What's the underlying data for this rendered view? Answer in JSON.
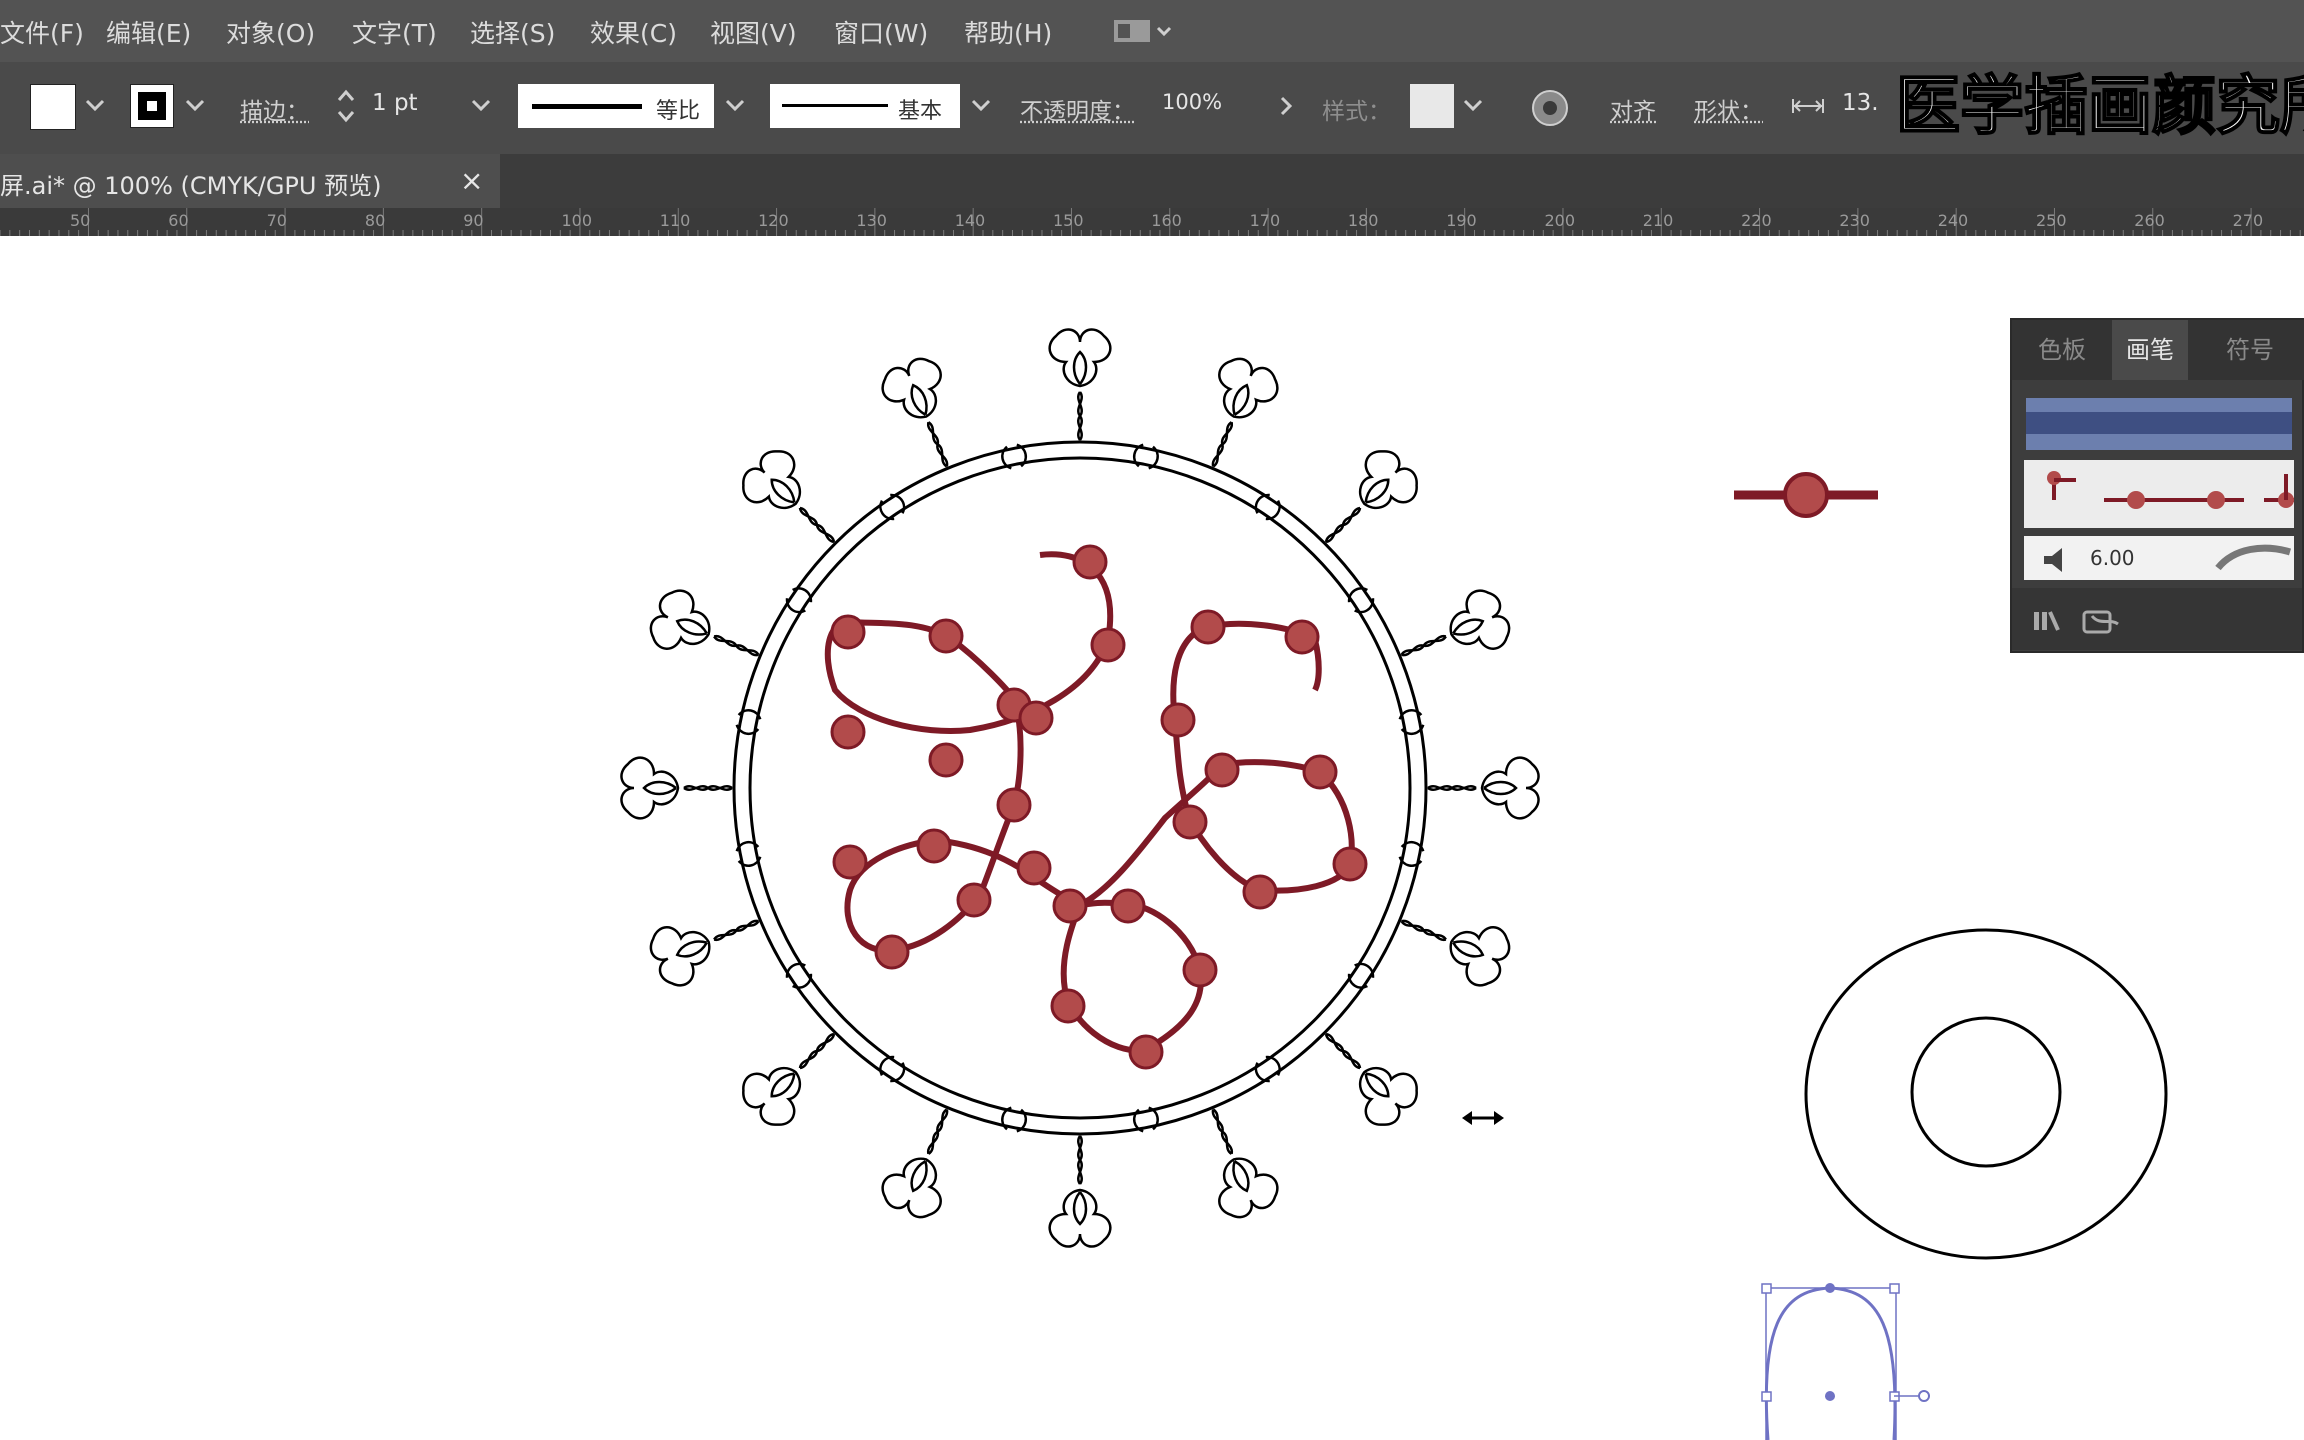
{
  "menubar": {
    "items": [
      "文件(F)",
      "编辑(E)",
      "对象(O)",
      "文字(T)",
      "选择(S)",
      "效果(C)",
      "视图(V)",
      "窗口(W)",
      "帮助(H)"
    ]
  },
  "control_bar": {
    "stroke_label": "描边：",
    "stroke_weight": "1 pt",
    "profile_label": "等比",
    "brush_label": "基本",
    "opacity_label": "不透明度：",
    "opacity_value": "100%",
    "style_label": "样式：",
    "align_label": "对齐",
    "shape_label": "形状：",
    "width_value": "13."
  },
  "document_tab": {
    "title": "屏.ai* @ 100% (CMYK/GPU 预览)",
    "close_glyph": "×"
  },
  "ruler": {
    "labels": [
      "50",
      "60",
      "70",
      "80",
      "90",
      "100",
      "110",
      "120",
      "130",
      "140",
      "150",
      "160",
      "170",
      "180",
      "190",
      "200",
      "210",
      "220",
      "230",
      "240",
      "250",
      "260",
      "270"
    ]
  },
  "brushes_panel": {
    "tabs": [
      "色板",
      "画笔",
      "符号"
    ],
    "active_tab": "画笔",
    "stroke_value": "6.00"
  },
  "watermark": "医学插画颜究所",
  "colors": {
    "menu_bg": "#535353",
    "control_bg": "#4a4a4a",
    "rna_red": "#7e1a26",
    "bead_red": "#b24b4b",
    "selection_blue": "#6f72c4"
  }
}
